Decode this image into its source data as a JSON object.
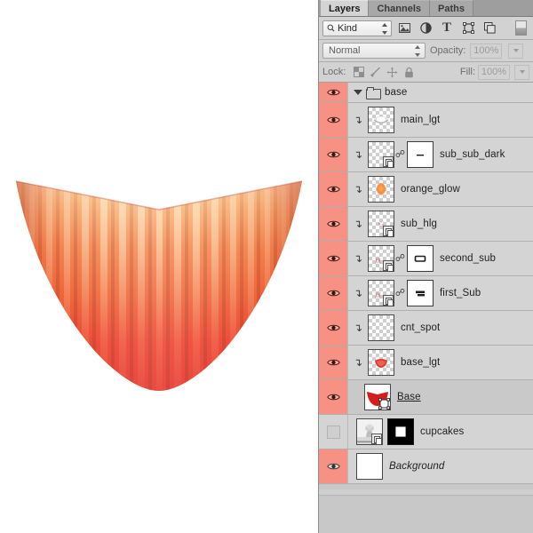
{
  "app": {
    "panel_title": "Layers"
  },
  "tabs": [
    {
      "label": "Layers",
      "active": true
    },
    {
      "label": "Channels",
      "active": false
    },
    {
      "label": "Paths",
      "active": false
    }
  ],
  "filter_row": {
    "kind_label": "Kind",
    "search_icon": "search-icon",
    "icons": [
      {
        "name": "pixel-layer-filter-icon",
        "glyph": "image"
      },
      {
        "name": "adjustment-layer-filter-icon",
        "glyph": "halfcircle"
      },
      {
        "name": "type-layer-filter-icon",
        "glyph": "T"
      },
      {
        "name": "shape-layer-filter-icon",
        "glyph": "shape"
      },
      {
        "name": "smart-object-filter-icon",
        "glyph": "smart"
      }
    ],
    "filter_toggle": "filter-enable-toggle"
  },
  "blend_row": {
    "blend_mode": "Normal",
    "opacity_label": "Opacity:",
    "opacity_value": "100%"
  },
  "lock_row": {
    "lock_label": "Lock:",
    "lock_icons": [
      "lock-transparent-pixels-icon",
      "lock-image-pixels-icon",
      "lock-position-icon",
      "lock-all-icon"
    ],
    "fill_label": "Fill:",
    "fill_value": "100%"
  },
  "colors": {
    "visible_eye_cell": "#F79183",
    "row_background": "#D4D4D4",
    "row_selected": "#C9C9C9",
    "panel_background": "#CFCFCF",
    "tab_active": "#D4D4D4",
    "tab_inactive": "#A8A8A8",
    "cupcake_red": "#E8342B",
    "cupcake_orange": "#F07C3C",
    "cupcake_highlight": "#FBD9A8"
  },
  "layers": [
    {
      "name": "base",
      "type": "group",
      "visible": true,
      "expanded": true,
      "clipped": false,
      "has_mask": false,
      "has_fx": false,
      "selected": false,
      "thumb": "none"
    },
    {
      "name": "main_lgt",
      "type": "pixel",
      "visible": true,
      "clipped": true,
      "has_mask": false,
      "has_fx": false,
      "selected": false,
      "thumb": "soft-white-glow"
    },
    {
      "name": "sub_sub_dark",
      "type": "pixel",
      "visible": true,
      "clipped": true,
      "has_mask": true,
      "has_fx": true,
      "selected": false,
      "thumb": "transparent-faint",
      "mask_thumb": "thin-dash"
    },
    {
      "name": "orange_glow",
      "type": "pixel",
      "visible": true,
      "clipped": true,
      "has_mask": false,
      "has_fx": false,
      "selected": false,
      "thumb": "orange-blob"
    },
    {
      "name": "sub_hlg",
      "type": "pixel",
      "visible": true,
      "clipped": true,
      "has_mask": false,
      "has_fx": true,
      "selected": false,
      "thumb": "tiny-pink-specks"
    },
    {
      "name": "second_sub",
      "type": "pixel",
      "visible": true,
      "clipped": true,
      "has_mask": true,
      "has_fx": true,
      "selected": false,
      "thumb": "tiny-red-marks",
      "mask_thumb": "rounded-rect"
    },
    {
      "name": "first_Sub",
      "type": "pixel",
      "visible": true,
      "clipped": true,
      "has_mask": true,
      "has_fx": true,
      "selected": false,
      "thumb": "tiny-red-marks",
      "mask_thumb": "stacked-bar"
    },
    {
      "name": "cnt_spot",
      "type": "pixel",
      "visible": true,
      "clipped": true,
      "has_mask": false,
      "has_fx": false,
      "selected": false,
      "thumb": "empty-transparent"
    },
    {
      "name": "base_lgt",
      "type": "pixel",
      "visible": true,
      "clipped": true,
      "has_mask": false,
      "has_fx": false,
      "selected": false,
      "thumb": "red-blob"
    },
    {
      "name": "Base",
      "type": "shape",
      "visible": true,
      "clipped": false,
      "has_mask": false,
      "has_fx": false,
      "selected": true,
      "thumb": "red-cupcake-wrapper"
    },
    {
      "name": "cupcakes",
      "type": "pixel",
      "visible": false,
      "clipped": false,
      "has_mask": true,
      "has_fx": true,
      "selected": false,
      "thumb": "grey-photo",
      "mask_thumb": "black-with-white-square"
    },
    {
      "name": "Background",
      "type": "background",
      "visible": true,
      "clipped": false,
      "has_mask": false,
      "has_fx": false,
      "selected": false,
      "thumb": "white"
    }
  ],
  "canvas": {
    "artwork_name": "cupcake-wrapper-illustration",
    "description": "Fluted red-orange cupcake liner with vertical pleats on white background"
  }
}
